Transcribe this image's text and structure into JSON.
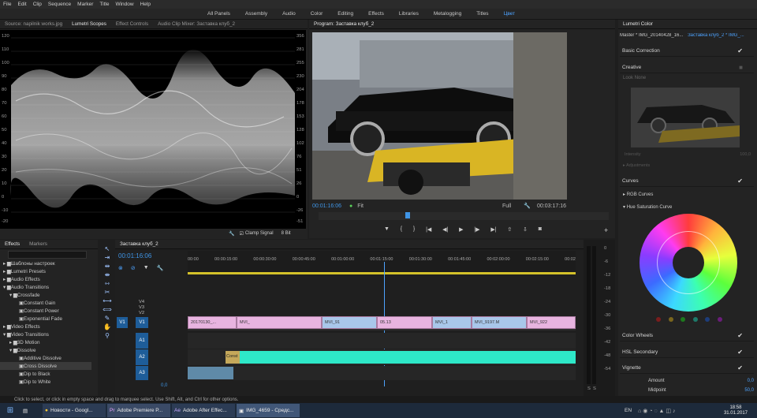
{
  "menu": [
    "File",
    "Edit",
    "Clip",
    "Sequence",
    "Marker",
    "Title",
    "Window",
    "Help"
  ],
  "workspaces": [
    "All Panels",
    "Assembly",
    "Audio",
    "Color",
    "Editing",
    "Effects",
    "Libraries",
    "Metalogging",
    "Titles",
    "Цвет"
  ],
  "source_tabs": [
    "Source: napilnik works.jpg",
    "Lumetri Scopes",
    "Effect Controls",
    "Audio Clip Mixer: Заставка клуб_2"
  ],
  "scope_left": [
    "120",
    "110",
    "100",
    "90",
    "80",
    "70",
    "60",
    "50",
    "40",
    "30",
    "20",
    "10",
    "0",
    "-10",
    "-20"
  ],
  "scope_right": [
    "356",
    "281",
    "255",
    "230",
    "204",
    "178",
    "153",
    "128",
    "102",
    "76",
    "51",
    "26",
    "0",
    "-26",
    "-51"
  ],
  "scope_footer": {
    "clamp": "Clamp Signal",
    "bits": "8 Bit"
  },
  "program": {
    "title": "Program: Заставка клуб_2",
    "timecode": "00:01:16:06",
    "fit": "Fit",
    "quality": "Full",
    "duration": "00:03:17:16"
  },
  "lumetri": {
    "title": "Lumetri Color",
    "master": "Master * IMG_20140428_16...",
    "seq": "Заставка клуб_2 * IMG_...",
    "basic": "Basic Correction",
    "creative": "Creative",
    "look": "Look",
    "look_val": "None",
    "intensity": "Intensity",
    "intensity_val": "100,0",
    "adjustments": "Adjustments",
    "curves": "Curves",
    "rgb": "RGB Curves",
    "hue": "Hue Saturation Curve",
    "wheels": "Color Wheels",
    "hsl": "HSL Secondary",
    "vignette": "Vignette",
    "amount": "Amount",
    "amount_val": "0,0",
    "midpoint": "Midpoint",
    "midpoint_val": "50,0"
  },
  "effects_tabs": [
    "Effects",
    "Markers"
  ],
  "effects_tree": [
    "Шаблоны настроек",
    "Lumetri Presets",
    "Audio Effects",
    "Audio Transitions",
    "Crossfade",
    "Constant Gain",
    "Constant Power",
    "Exponential Fade",
    "Video Effects",
    "Video Transitions",
    "3D Motion",
    "Dissolve",
    "Additive Dissolve",
    "Cross Dissolve",
    "Dip to Black",
    "Dip to White"
  ],
  "timeline": {
    "title": "Заставка клуб_2",
    "timecode": "00:01:16:06",
    "ruler": [
      "00:00",
      "00:00:15:00",
      "00:00:30:00",
      "00:00:45:00",
      "00:01:00:00",
      "00:01:15:00",
      "00:01:30:00",
      "00:01:45:00",
      "00:02:00:00",
      "00:02:15:00",
      "00:02"
    ],
    "tracks": [
      "V4",
      "V3",
      "V2",
      "V1",
      "A1",
      "A2",
      "A3"
    ],
    "v1_src": "V1",
    "vol": "0,0",
    "clips": [
      "20170130_...",
      "MVI_",
      "MVI_91",
      "05.13",
      "MVI_1",
      "MVI_9197.M",
      "MVI_922"
    ],
    "audio_clip": "Const"
  },
  "meter_labels": [
    "0",
    "-6",
    "-12",
    "-18",
    "-24",
    "-30",
    "-36",
    "-42",
    "-48",
    "-54"
  ],
  "meter_foot": [
    "S",
    "S"
  ],
  "status_text": "Click to select, or click in empty space and drag to marquee select. Use Shift, Alt, and Ctrl for other options.",
  "taskbar": {
    "items": [
      "Новости - Googl...",
      "Adobe Premiere P...",
      "Adobe After Effec...",
      "IMG_4659 - Средс..."
    ],
    "lang": "EN",
    "time": "18:58",
    "date": "31.01.2017"
  }
}
